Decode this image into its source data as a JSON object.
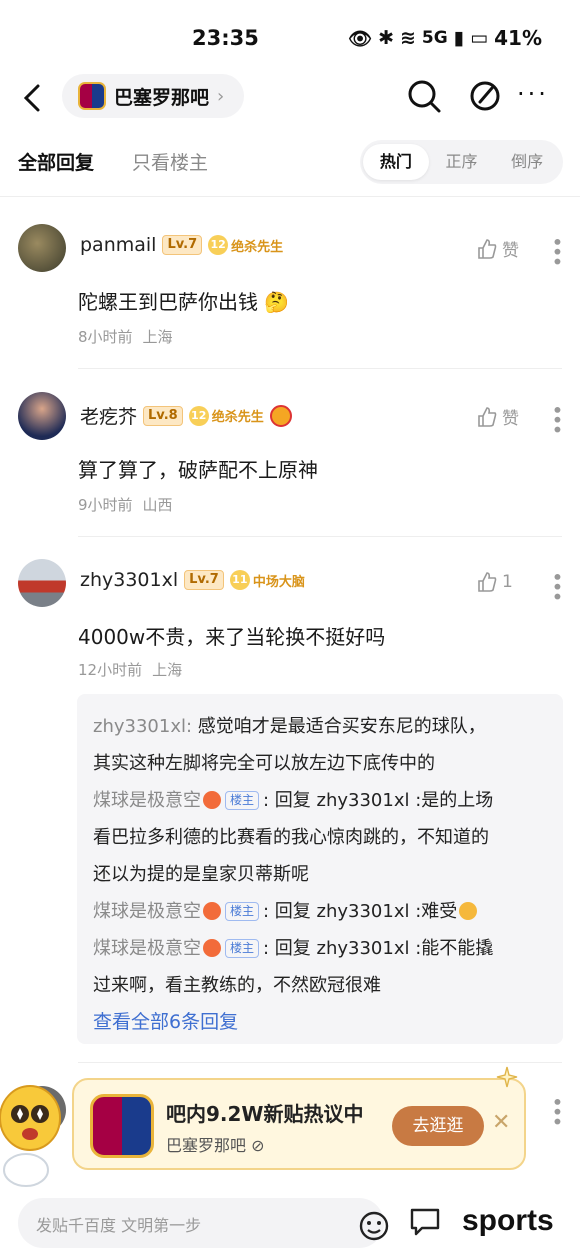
{
  "status_bar": {
    "time": "23:35",
    "battery": "41%",
    "network": "5G"
  },
  "nav": {
    "forum_name": "巴塞罗那吧"
  },
  "tabs": {
    "all_replies": "全部回复",
    "owner_only": "只看楼主"
  },
  "sort": {
    "hot": "热门",
    "asc": "正序",
    "desc": "倒序",
    "active": "hot"
  },
  "comments": [
    {
      "user": "panmail",
      "level": "Lv.7",
      "badge_num": "12",
      "badge": "绝杀先生",
      "like": "赞",
      "text": "陀螺王到巴萨你出钱 🤔",
      "time": "8小时前",
      "location": "上海"
    },
    {
      "user": "老疙芥",
      "level": "Lv.8",
      "badge_num": "12",
      "badge": "绝杀先生",
      "like": "赞",
      "text": "算了算了，破萨配不上原神",
      "time": "9小时前",
      "location": "山西"
    },
    {
      "user": "zhy3301xl",
      "level": "Lv.7",
      "badge_num": "11",
      "badge": "中场大脑",
      "like": "1",
      "text": "4000w不贵，来了当轮换不挺好吗",
      "time": "12小时前",
      "location": "上海"
    }
  ],
  "replies": [
    {
      "user": "zhy3301xl:",
      "text1": " 感觉咱才是最适合买安东尼的球队，",
      "text2": "其实这种左脚将完全可以放左边下底传中的"
    },
    {
      "user": "煤球是极意空",
      "tag": "楼主",
      "text1": ": 回复 zhy3301xl :是的上场",
      "text2": "看巴拉多利德的比赛看的我心惊肉跳的，不知道的",
      "text3": "还以为提的是皇家贝蒂斯呢"
    },
    {
      "user": "煤球是极意空",
      "tag": "楼主",
      "text1": ": 回复 zhy3301xl :难受"
    },
    {
      "user": "煤球是极意空",
      "tag": "楼主",
      "text1": ": 回复 zhy3301xl :能不能撬",
      "text2": "过来啊，看主教练的，不然欧冠很难"
    }
  ],
  "more_replies": "查看全部6条回复",
  "promo": {
    "title": "吧内9.2W新贴热议中",
    "subtitle": "巴塞罗那吧",
    "button": "去逛逛"
  },
  "bottom": {
    "placeholder": "发贴千百度 文明第一步",
    "watermark": "sports"
  },
  "colors": {
    "link_blue": "#3f6fd1",
    "promo_button": "#c87a43",
    "level_bg": "#fde8c4",
    "badge_gold": "#d9941a"
  }
}
